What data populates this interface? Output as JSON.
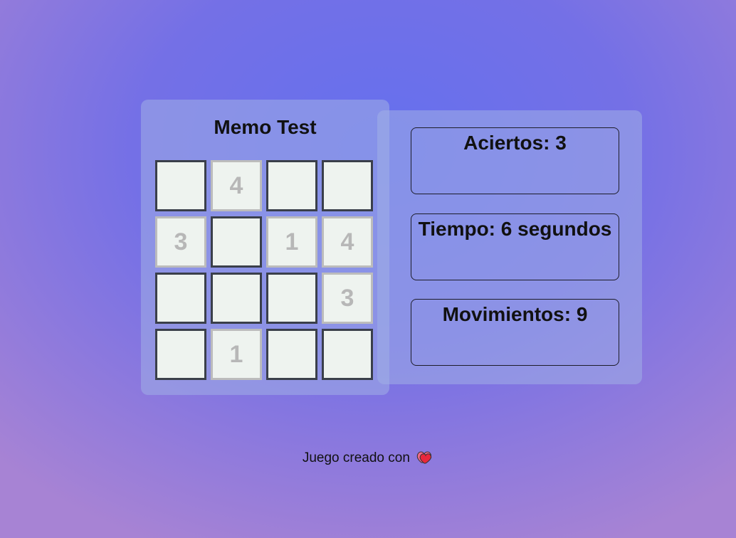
{
  "game": {
    "title": "Memo Test",
    "tiles": [
      {
        "value": ""
      },
      {
        "value": "4"
      },
      {
        "value": ""
      },
      {
        "value": ""
      },
      {
        "value": "3"
      },
      {
        "value": ""
      },
      {
        "value": "1"
      },
      {
        "value": "4"
      },
      {
        "value": ""
      },
      {
        "value": ""
      },
      {
        "value": ""
      },
      {
        "value": "3"
      },
      {
        "value": ""
      },
      {
        "value": "1"
      },
      {
        "value": ""
      },
      {
        "value": ""
      }
    ]
  },
  "stats": {
    "hits": "Aciertos: 3",
    "time": "Tiempo: 6 segundos",
    "moves": "Movimientos: 9"
  },
  "footer": {
    "text": "Juego creado con",
    "icon": "heart-icon"
  },
  "colors": {
    "tile_bg": "#eef3ef",
    "tile_border_hidden": "#3a3f4a",
    "tile_border_revealed": "#bcbcbc",
    "tile_number": "#b7b7b7",
    "heart": "#e8283c"
  }
}
